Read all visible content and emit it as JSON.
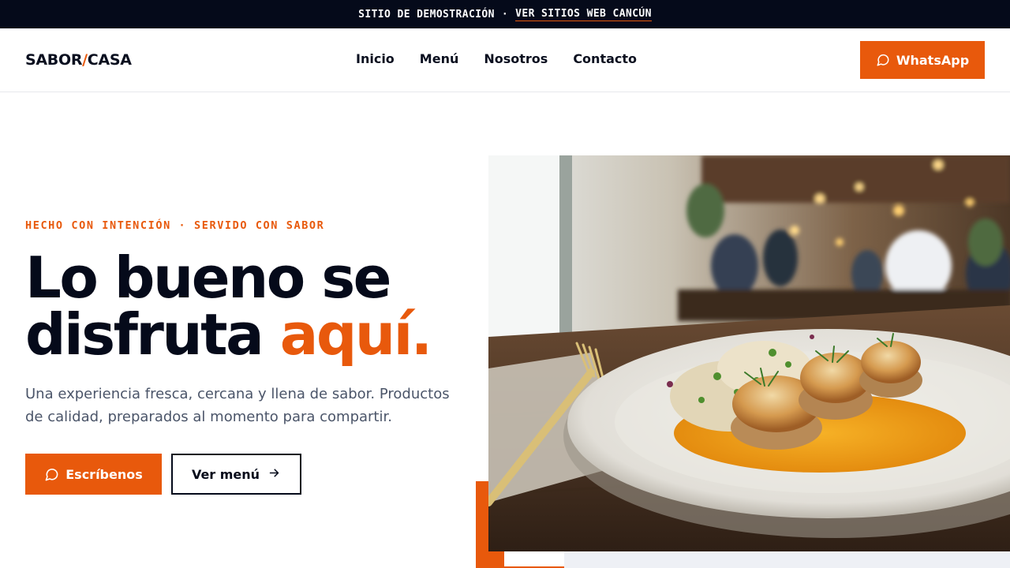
{
  "topbar": {
    "label": "SITIO DE DEMOSTRACIÓN",
    "separator": "·",
    "link": "VER SITIOS WEB CANCÚN"
  },
  "header": {
    "logo": {
      "part1": "SABOR",
      "slash": "/",
      "part2": "CASA"
    },
    "nav": [
      "Inicio",
      "Menú",
      "Nosotros",
      "Contacto"
    ],
    "cta": {
      "label": "WhatsApp",
      "icon": "chat-bubble-icon"
    }
  },
  "hero": {
    "eyebrow": "HECHO CON INTENCIÓN · SERVIDO CON SABOR",
    "title_line1": "Lo bueno se",
    "title_line2": "disfruta ",
    "title_accent": "aquí.",
    "lead": "Una experiencia fresca, cercana y llena de sabor. Productos de calidad, preparados al momento para compartir.",
    "primary_button": {
      "label": "Escríbenos",
      "icon": "chat-bubble-icon"
    },
    "secondary_button": {
      "label": "Ver menú",
      "icon": "arrow-right-icon"
    },
    "image": {
      "subject": "seared-scallops-dish-restaurant-photo"
    }
  },
  "colors": {
    "accent": "#e8590c",
    "dark": "#050a1a",
    "muted_text": "#4b5569"
  }
}
